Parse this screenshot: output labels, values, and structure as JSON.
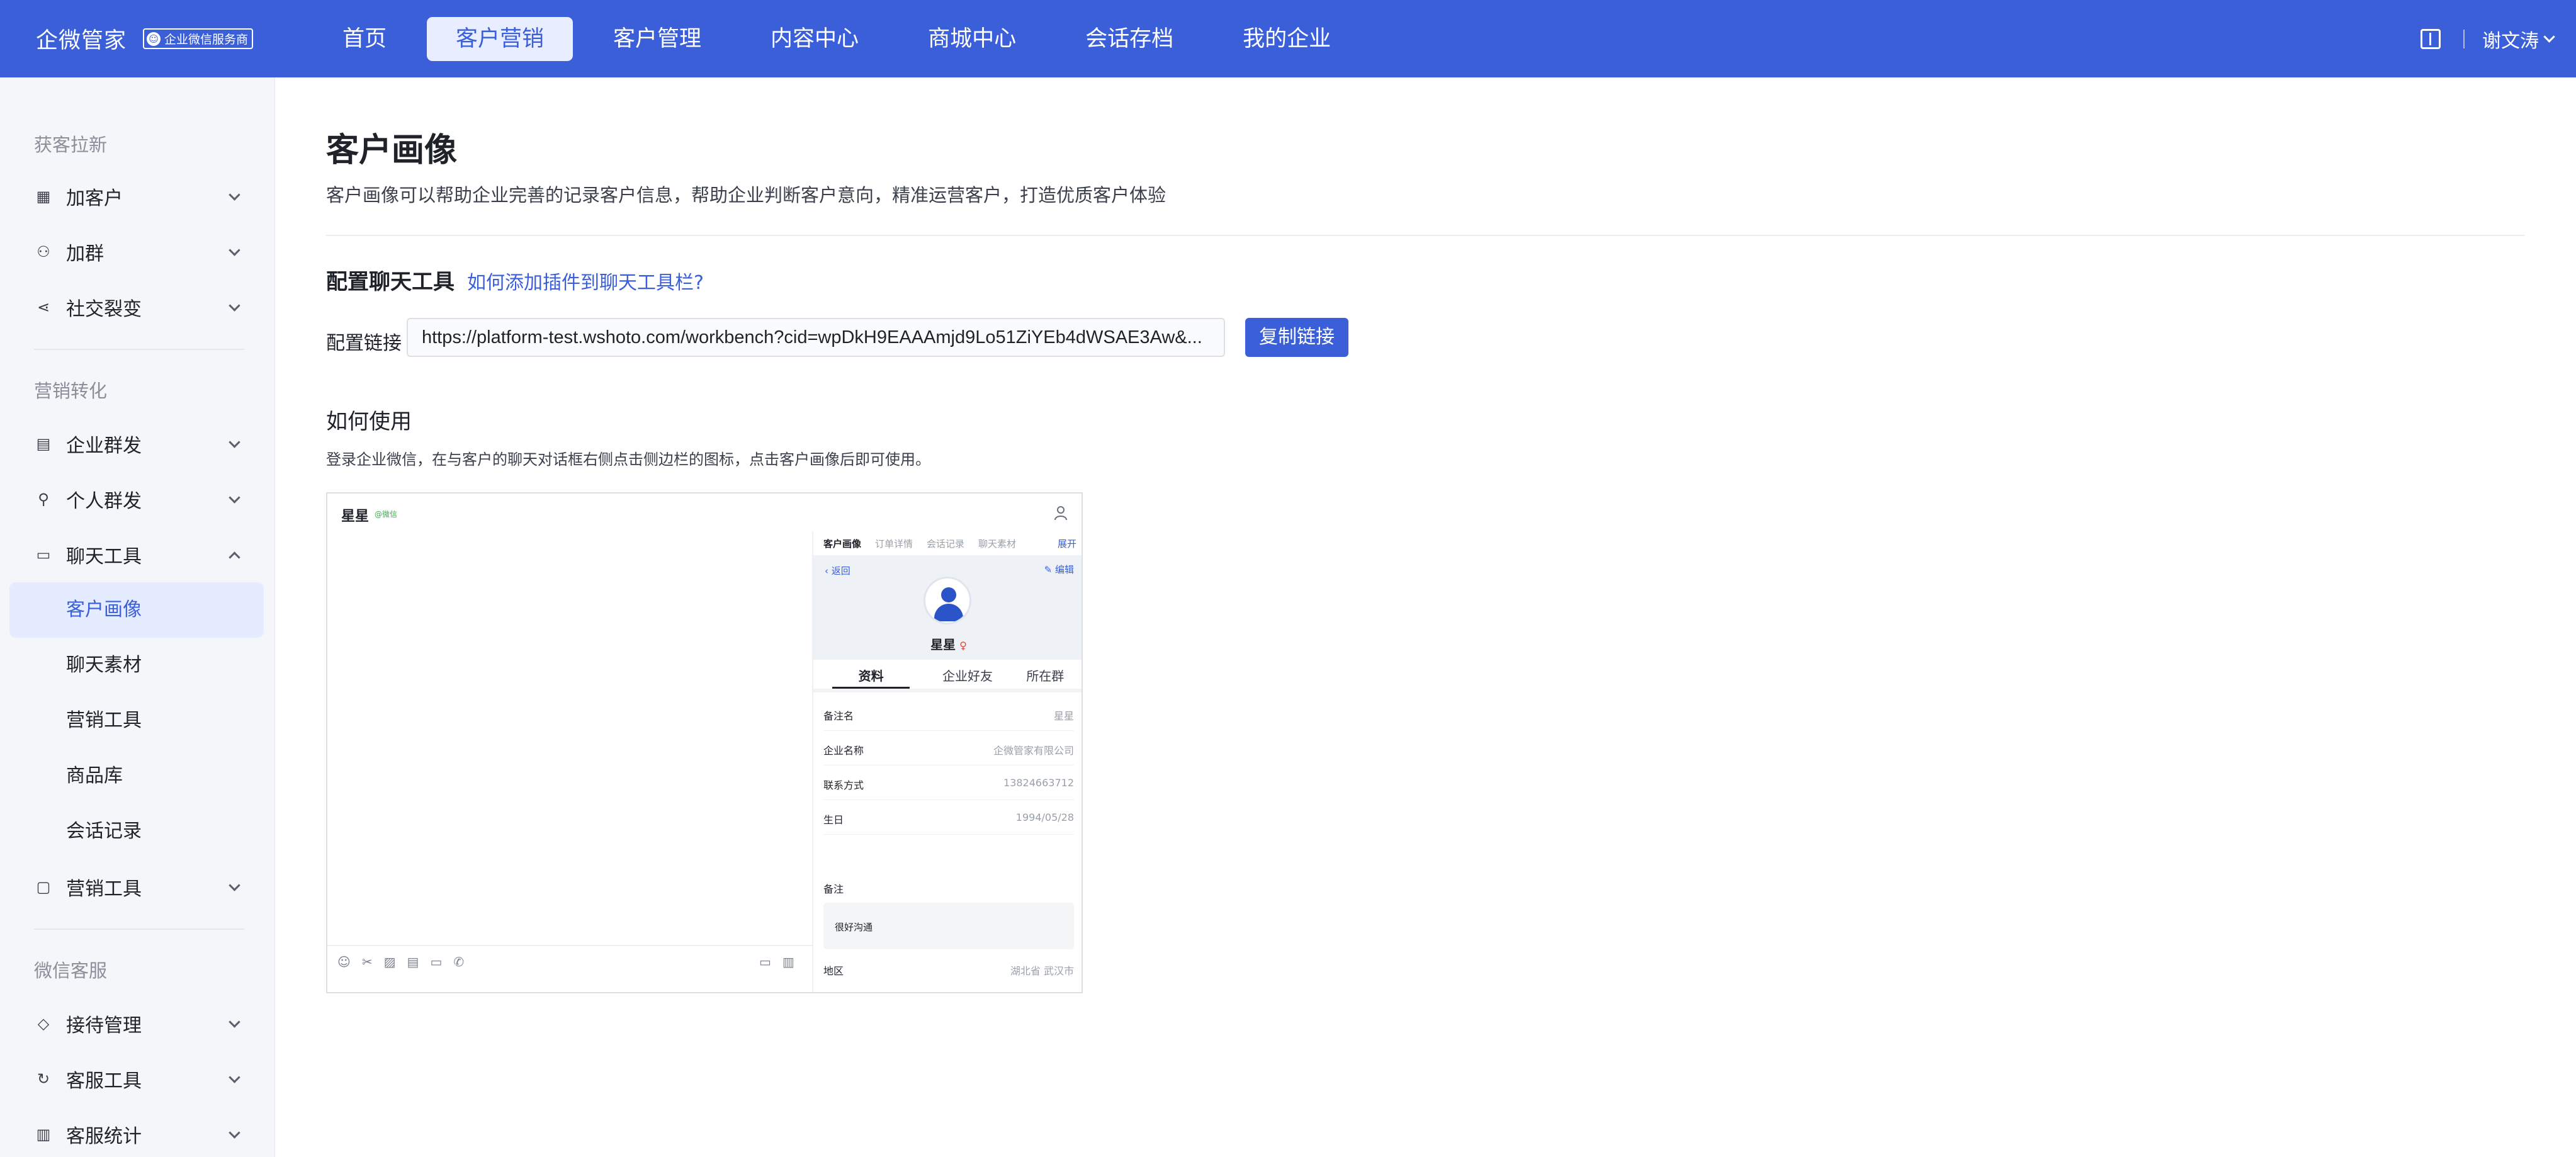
{
  "header": {
    "brand": "企微管家",
    "badge": "企业微信服务商",
    "nav": [
      "首页",
      "客户营销",
      "客户管理",
      "内容中心",
      "商城中心",
      "会话存档",
      "我的企业"
    ],
    "active_nav": "客户营销",
    "user": "谢文涛"
  },
  "sidebar": {
    "sections": [
      {
        "title": "获客拉新",
        "items": [
          "加客户",
          "加群",
          "社交裂变"
        ]
      },
      {
        "title": "营销转化",
        "items": [
          "企业群发",
          "个人群发",
          "聊天工具",
          "营销工具"
        ],
        "sub_items": [
          "客户画像",
          "聊天素材",
          "营销工具",
          "商品库",
          "会话记录"
        ]
      },
      {
        "title": "微信客服",
        "items": [
          "接待管理",
          "客服工具",
          "客服统计"
        ]
      }
    ],
    "active_sub": "客户画像"
  },
  "main": {
    "title": "客户画像",
    "desc": "客户画像可以帮助企业完善的记录客户信息，帮助企业判断客户意向，精准运营客户，打造优质客户体验",
    "config_title": "配置聊天工具",
    "help_link": "如何添加插件到聊天工具栏?",
    "link_label": "配置链接",
    "link_value": "https://platform-test.wshoto.com/workbench?cid=wpDkH9EAAAmjd9Lo51ZiYEb4dWSAE3Aw&...",
    "copy_button": "复制链接",
    "howto_title": "如何使用",
    "howto_desc": "登录企业微信，在与客户的聊天对话框右侧点击侧边栏的图标，点击客户画像后即可使用。"
  },
  "preview": {
    "chat_name": "星星",
    "chat_tag": "@微信",
    "tabs": [
      "客户画像",
      "订单详情",
      "会话记录",
      "聊天素材"
    ],
    "tabs_more": "展开",
    "back": "返回",
    "edit": "编辑",
    "profile_name": "星星",
    "sub_tabs": [
      "资料",
      "企业好友",
      "所在群"
    ],
    "fields": [
      {
        "k": "备注名",
        "v": "星星"
      },
      {
        "k": "企业名称",
        "v": "企微管家有限公司"
      },
      {
        "k": "联系方式",
        "v": "13824663712"
      },
      {
        "k": "生日",
        "v": "1994/05/28"
      }
    ],
    "note_label": "备注",
    "note_value": "很好沟通",
    "region_label": "地区",
    "region_value": "湖北省 武汉市"
  },
  "colors": {
    "primary": "#3b5fd9",
    "active_bg": "#e5ecff",
    "sidebar_bg": "#f5f6f9"
  }
}
